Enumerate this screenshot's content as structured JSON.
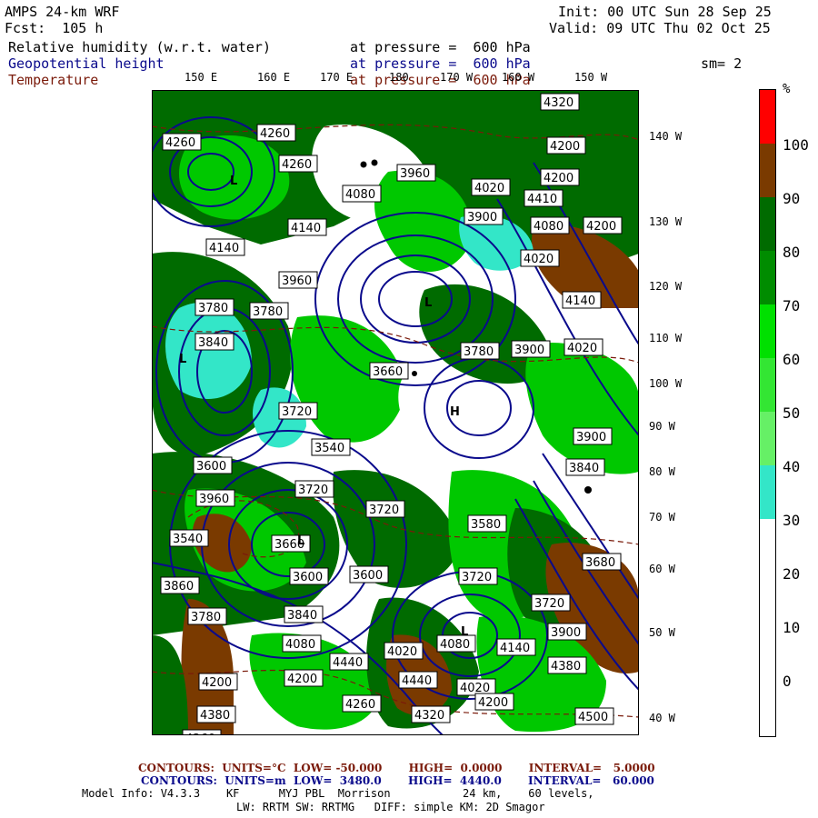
{
  "header": {
    "model": "AMPS 24-km WRF",
    "fcst": "Fcst:  105 h",
    "init": "Init: 00 UTC Sun 28 Sep 25",
    "valid": "Valid: 09 UTC Thu 02 Oct 25",
    "rh_label": "Relative humidity (w.r.t. water)",
    "rh_level": "at pressure =  600 hPa",
    "gh_label": "Geopotential height",
    "gh_level": "at pressure =  600 hPa",
    "temp_label": "Temperature",
    "temp_level": "at pressure =  600 hPa",
    "smooth": "sm= 2"
  },
  "map": {
    "lon_labels": [
      "150 E",
      "160 E",
      "170 E",
      "180",
      "170 W",
      "160 W",
      "150 W"
    ],
    "lat_labels": [
      "140 W",
      "130 W",
      "120 W",
      "110 W",
      "100 W",
      "90 W",
      "80 W",
      "70 W",
      "60 W",
      "50 W",
      "40 W"
    ],
    "height_labels": [
      "4320",
      "4260",
      "4260",
      "4200",
      "4260",
      "4200",
      "4080",
      "3960",
      "4020",
      "3900",
      "4080",
      "4140",
      "4200",
      "4140",
      "4140",
      "3960",
      "3780",
      "4020",
      "3780",
      "3900",
      "4020",
      "3840",
      "3780",
      "3660",
      "3720",
      "3540",
      "3600",
      "3720",
      "3580",
      "3960",
      "3900",
      "3840",
      "3720",
      "3660",
      "3540",
      "3600",
      "3600",
      "3720",
      "3860",
      "3680",
      "3780",
      "3840",
      "3720",
      "3900",
      "4080",
      "4140",
      "4200",
      "4020",
      "4080",
      "4020",
      "4260",
      "4200",
      "4380",
      "4440",
      "4200",
      "4500",
      "4380",
      "4260",
      "4320",
      "4440",
      "4410"
    ],
    "low_markers": [
      "L",
      "L",
      "L",
      "L",
      "L"
    ],
    "high_markers": [
      "H"
    ]
  },
  "colorbar": {
    "unit": "%",
    "labels": [
      "100",
      "90",
      "80",
      "70",
      "60",
      "50",
      "40",
      "30",
      "20",
      "10",
      "0"
    ],
    "colors": [
      "#ff0000",
      "#7a3a00",
      "#006b00",
      "#008c00",
      "#00c800",
      "#33e633",
      "#66f066",
      "#33e6c8",
      "#ffffff",
      "#ffffff",
      "#ffffff",
      "#ffffff"
    ]
  },
  "footer": {
    "temp_contours": "CONTOURS:  UNITS=°C  LOW= -50.000       HIGH=  0.0000       INTERVAL=   5.0000",
    "gh_contours": "CONTOURS:  UNITS=m  LOW=  3480.0       HIGH=  4440.0       INTERVAL=   60.000",
    "model_info": "Model Info: V4.3.3    KF      MYJ PBL  Morrison           24 km,    60 levels,",
    "physics": "LW: RRTM SW: RRTMG   DIFF: simple KM: 2D Smagor"
  },
  "colors": {
    "rh_dark": "#006b00",
    "rh_mid": "#00c800",
    "rh_light": "#33e6c8",
    "rh_high": "#7a3a00",
    "height_line": "#0a0a8c",
    "temp_line": "#7a1a0a"
  }
}
